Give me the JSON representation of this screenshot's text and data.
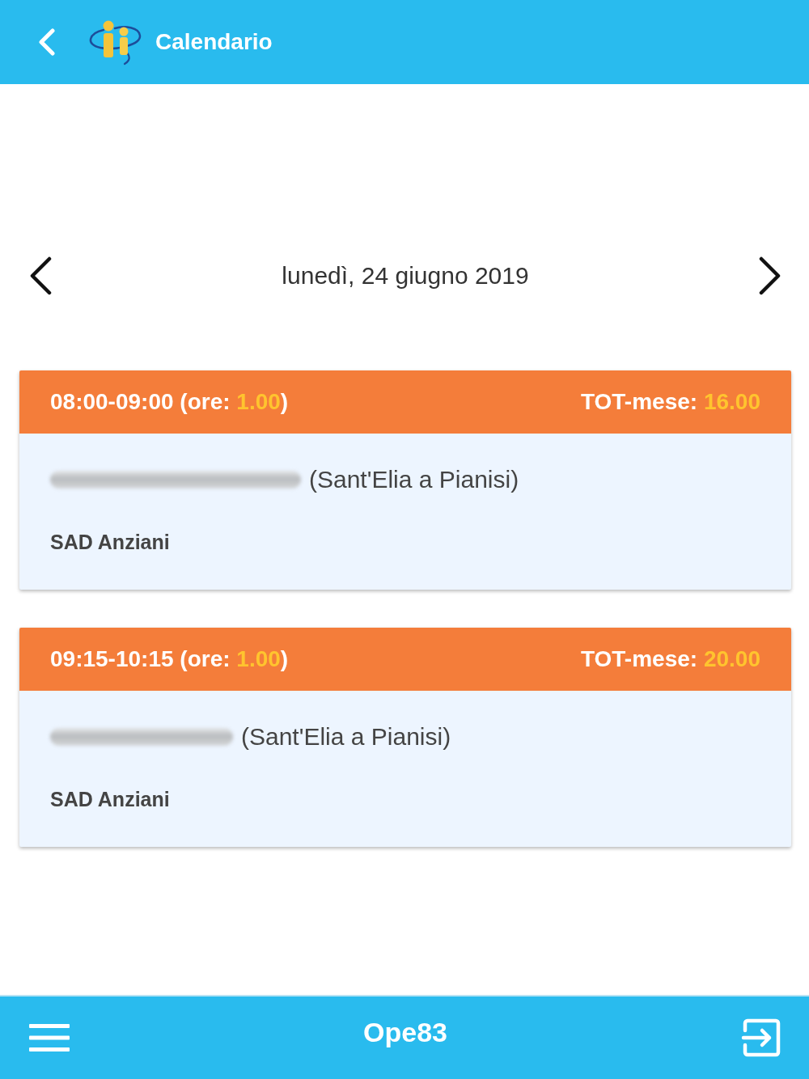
{
  "header": {
    "title": "Calendario"
  },
  "date_nav": {
    "date": "lunedì, 24 giugno 2019"
  },
  "appointments": [
    {
      "time_range": "08:00-09:00",
      "hours_label": "(ore:",
      "hours": "1.00",
      "hours_close": ")",
      "month_total_label": "TOT-mese:",
      "month_total": "16.00",
      "name_redacted": true,
      "location": "(Sant'Elia a Pianisi)",
      "service": "SAD Anziani"
    },
    {
      "time_range": "09:15-10:15",
      "hours_label": "(ore:",
      "hours": "1.00",
      "hours_close": ")",
      "month_total_label": "TOT-mese:",
      "month_total": "20.00",
      "name_redacted": true,
      "location": "(Sant'Elia a Pianisi)",
      "service": "SAD Anziani"
    }
  ],
  "footer": {
    "operator": "Ope83"
  }
}
